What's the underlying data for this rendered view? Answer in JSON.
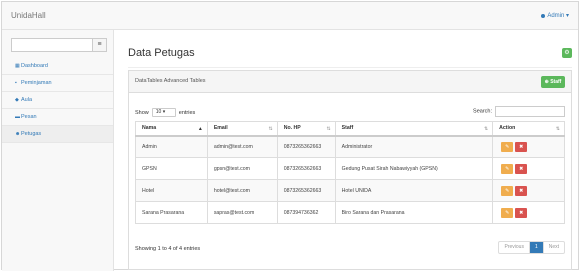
{
  "app": {
    "brand": "UnidaHall",
    "user": "Admin ▾"
  },
  "sidebar": {
    "search_button": "≡",
    "items": [
      {
        "icon": "▦",
        "label": "Dashboard",
        "active": false
      },
      {
        "icon": "▪",
        "label": "Peminjaman",
        "active": false
      },
      {
        "icon": "◆",
        "label": "Aula",
        "active": false
      },
      {
        "icon": "▬",
        "label": "Pesan",
        "active": false
      },
      {
        "icon": "☻",
        "label": "Petugas",
        "active": true
      }
    ]
  },
  "main": {
    "title": "Data Petugas",
    "gear": "⚙",
    "panel_title": "DataTables Advanced Tables",
    "add_staff": "⊕ Staff",
    "show_label": "Show",
    "show_value": "10 ▾",
    "entries_label": "entries",
    "search_label": "Search:",
    "columns": [
      {
        "label": "Nama",
        "sort": "▲",
        "sorted": true
      },
      {
        "label": "Email",
        "sort": "⇅",
        "sorted": false
      },
      {
        "label": "No. HP",
        "sort": "⇅",
        "sorted": false
      },
      {
        "label": "Staff",
        "sort": "⇅",
        "sorted": false
      },
      {
        "label": "Action",
        "sort": "⇅",
        "sorted": false
      }
    ],
    "rows": [
      {
        "nama": "Admin",
        "email": "admin@test.com",
        "hp": "0873265362663",
        "staff": "Administrator"
      },
      {
        "nama": "GPSN",
        "email": "gpsn@test.com",
        "hp": "0873265362663",
        "staff": "Gedung Pusat Sirah Nabawiyyah (GPSN)"
      },
      {
        "nama": "Hotel",
        "email": "hotel@test.com",
        "hp": "0873265362663",
        "staff": "Hotel UNIDA"
      },
      {
        "nama": "Sarana Prasarana",
        "email": "sapras@test.com",
        "hp": "087394736362",
        "staff": "Biro Sarana dan Prasarana"
      }
    ],
    "info": "Showing 1 to 4 of 4 entries",
    "pager": {
      "prev": "Previous",
      "page": "1",
      "next": "Next"
    },
    "edit_icon": "✎",
    "delete_icon": "✖"
  },
  "colors": {
    "primary": "#337ab7",
    "success": "#5cb85c",
    "warning": "#f0ad4e",
    "danger": "#d9534f"
  }
}
